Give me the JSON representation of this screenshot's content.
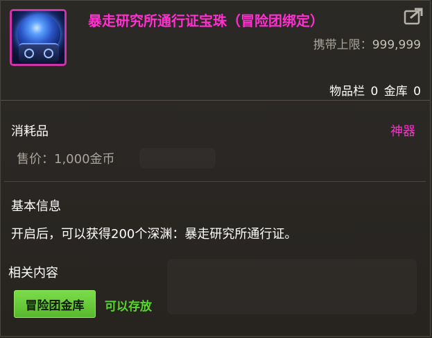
{
  "item": {
    "title": "暴走研究所通行证宝珠（冒险团绑定）",
    "icon": "blue-orb-icon",
    "carry_limit_label": "携带上限：",
    "carry_limit_value": "999,999",
    "inventory_label": "物品栏",
    "inventory_count": "0",
    "vault_label": "金库",
    "vault_count": "0"
  },
  "details": {
    "type": "消耗品",
    "rarity": "神器",
    "price_label": "售价：",
    "price_value": "1,000金币"
  },
  "basic_info": {
    "title": "基本信息",
    "description": "开启后，可以获得200个深渊：暴走研究所通行证。"
  },
  "related": {
    "title": "相关内容",
    "storage_button": "冒险团金库",
    "storage_status": "可以存放"
  },
  "colors": {
    "rarity_artifact": "#ff2fd0",
    "storage_green": "#58b82d",
    "status_green": "#55d82a"
  }
}
